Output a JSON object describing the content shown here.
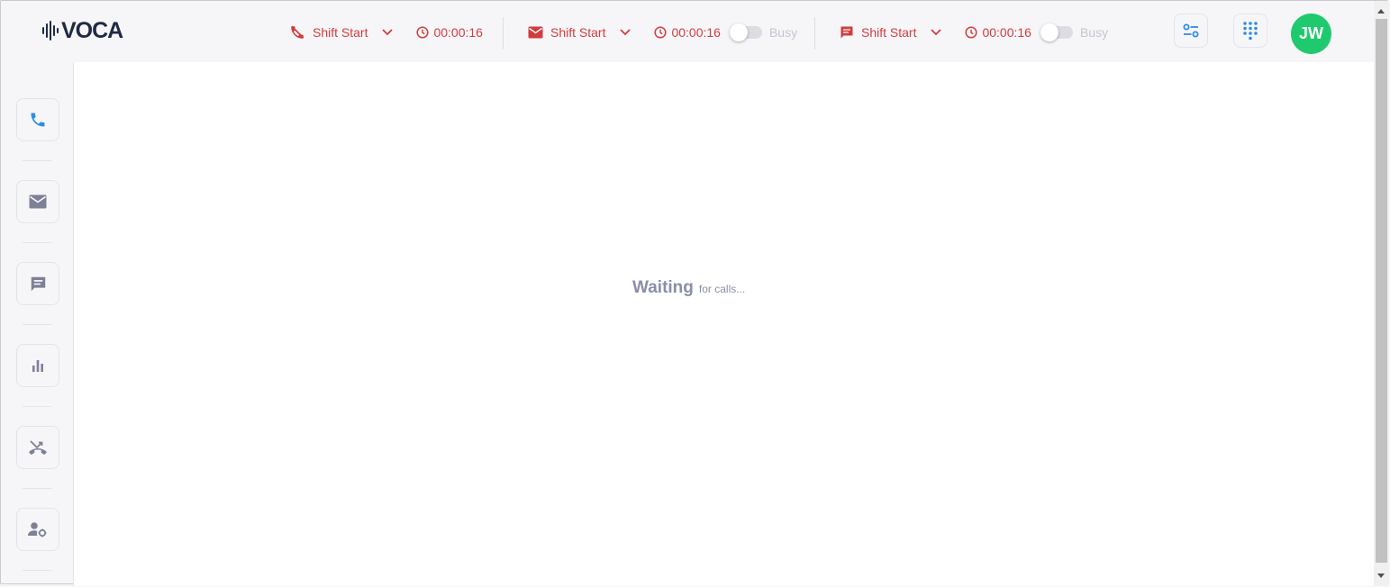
{
  "app": {
    "logo_text": "VOCA"
  },
  "header": {
    "channels": [
      {
        "id": "voice",
        "status": "Shift Start",
        "timer": "00:00:16"
      },
      {
        "id": "email",
        "status": "Shift Start",
        "timer": "00:00:16",
        "toggle_label": "Busy",
        "toggle_on": false
      },
      {
        "id": "chat",
        "status": "Shift Start",
        "timer": "00:00:16",
        "toggle_label": "Busy",
        "toggle_on": false
      }
    ],
    "avatar_initials": "JW"
  },
  "sidebar": {
    "items": [
      {
        "icon": "phone-icon",
        "active": true
      },
      {
        "icon": "mail-icon"
      },
      {
        "icon": "chat-icon"
      },
      {
        "icon": "bar-chart-icon"
      },
      {
        "icon": "missed-call-icon"
      },
      {
        "icon": "user-settings-icon"
      }
    ]
  },
  "main": {
    "waiting_title": "Waiting",
    "waiting_sub": "for calls..."
  },
  "colors": {
    "accent_blue": "#2f8ee5",
    "status_red": "#d23c3c",
    "avatar_green": "#1fca6e",
    "icon_gray": "#7e8096",
    "waiting_text": "#8a8ea8"
  }
}
